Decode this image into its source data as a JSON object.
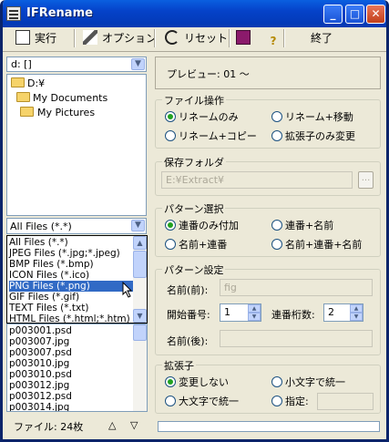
{
  "window": {
    "title": "IFRename",
    "min": "_",
    "max": "□",
    "close": "✕"
  },
  "toolbar": {
    "run": "実行",
    "options": "オプション",
    "reset": "リセット",
    "exit": "終了"
  },
  "drive": {
    "value": "d: []"
  },
  "tree": {
    "items": [
      "D:¥",
      "My Documents",
      "My Pictures"
    ]
  },
  "filter": {
    "selected": "All Files (*.*)",
    "options": [
      "All Files (*.*)",
      "JPEG Files (*.jpg;*.jpeg)",
      "BMP Files (*.bmp)",
      "ICON Files (*.ico)",
      "PNG Files (*.png)",
      "GIF Files (*.gif)",
      "TEXT Files (*.txt)",
      "HTML Files (*.html;*.htm)"
    ]
  },
  "files": [
    "p003001.psd",
    "p003007.jpg",
    "p003007.psd",
    "p003010.jpg",
    "p003010.psd",
    "p003012.jpg",
    "p003012.psd",
    "p003014.jpg"
  ],
  "status": {
    "count": "ファイル: 24枚",
    "up": "△",
    "down": "▽"
  },
  "preview": {
    "text": "プレビュー:  01 〜"
  },
  "fileop": {
    "legend": "ファイル操作",
    "opt1": "リネームのみ",
    "opt2": "リネーム+移動",
    "opt3": "リネーム+コピー",
    "opt4": "拡張子のみ変更"
  },
  "savefolder": {
    "legend": "保存フォルダ",
    "value": "E:¥Extract¥",
    "browse": "..."
  },
  "pattern": {
    "legend": "パターン選択",
    "opt1": "連番のみ付加",
    "opt2": "連番+名前",
    "opt3": "名前+連番",
    "opt4": "名前+連番+名前"
  },
  "patternset": {
    "legend": "パターン設定",
    "prefix_label": "名前(前):",
    "prefix_value": "fig",
    "start_label": "開始番号:",
    "start_value": "1",
    "digits_label": "連番桁数:",
    "digits_value": "2",
    "suffix_label": "名前(後):",
    "suffix_value": ""
  },
  "ext": {
    "legend": "拡張子",
    "opt1": "変更しない",
    "opt2": "小文字で統一",
    "opt3": "大文字で統一",
    "opt4": "指定:",
    "custom": ""
  }
}
